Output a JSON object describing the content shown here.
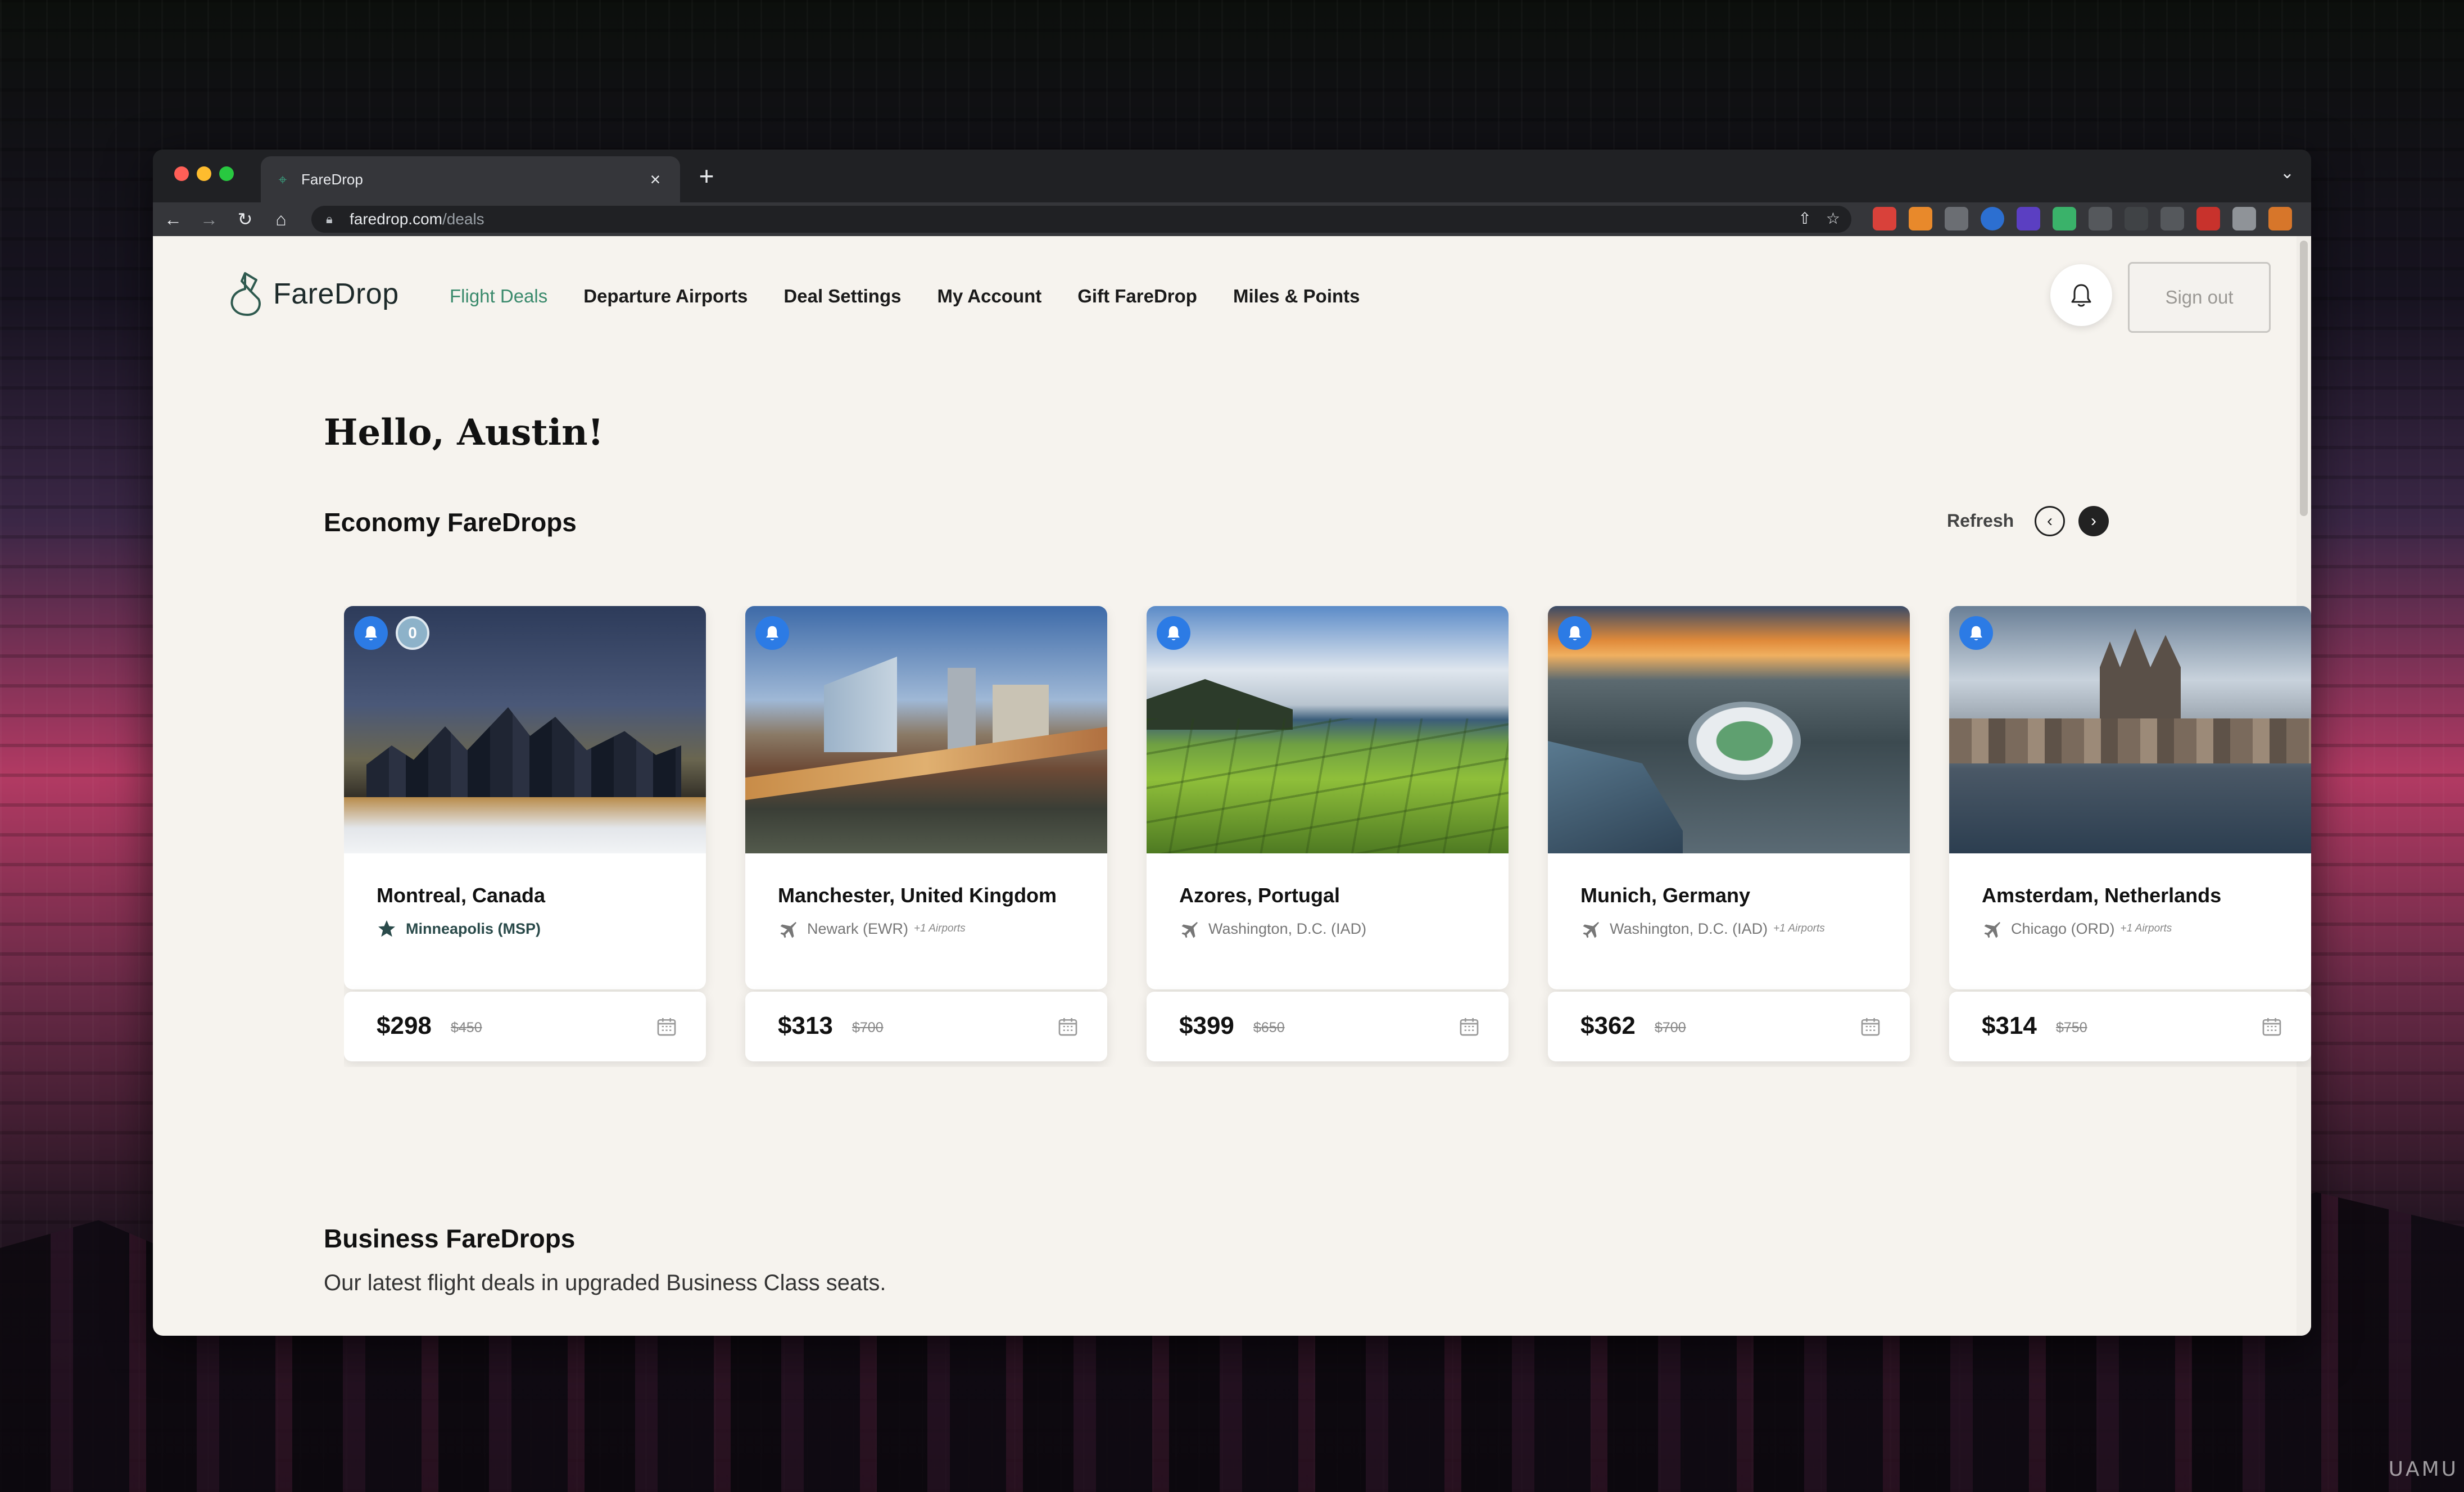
{
  "browser": {
    "tab_title": "FareDrop",
    "url_host": "faredrop.com",
    "url_path": "/deals"
  },
  "header": {
    "logo_text": "FareDrop",
    "nav": [
      {
        "label": "Flight Deals",
        "active": true
      },
      {
        "label": "Departure Airports",
        "active": false
      },
      {
        "label": "Deal Settings",
        "active": false
      },
      {
        "label": "My Account",
        "active": false
      },
      {
        "label": "Gift FareDrop",
        "active": false
      },
      {
        "label": "Miles & Points",
        "active": false
      }
    ],
    "signout_label": "Sign out"
  },
  "main": {
    "greeting": "Hello, Austin!",
    "economy_title": "Economy FareDrops",
    "refresh_label": "Refresh",
    "business_title": "Business FareDrops",
    "business_subtitle": "Our latest flight deals in upgraded Business Class seats."
  },
  "deals": [
    {
      "city": "Montreal, Canada",
      "origin": "Minneapolis (MSP)",
      "extra": "",
      "price": "$298",
      "old_price": "$450",
      "origin_icon": "star-icon",
      "badge_zero": "0"
    },
    {
      "city": "Manchester, United Kingdom",
      "origin": "Newark (EWR)",
      "extra": "+1 Airports",
      "price": "$313",
      "old_price": "$700",
      "origin_icon": "plane-icon"
    },
    {
      "city": "Azores, Portugal",
      "origin": "Washington, D.C. (IAD)",
      "extra": "",
      "price": "$399",
      "old_price": "$650",
      "origin_icon": "plane-icon"
    },
    {
      "city": "Munich, Germany",
      "origin": "Washington, D.C. (IAD)",
      "extra": "+1 Airports",
      "price": "$362",
      "old_price": "$700",
      "origin_icon": "plane-icon"
    },
    {
      "city": "Amsterdam, Netherlands",
      "origin": "Chicago (ORD)",
      "extra": "+1 Airports",
      "price": "$314",
      "old_price": "$750",
      "origin_icon": "plane-icon"
    }
  ],
  "colors": {
    "accent": "#3a8a6c",
    "badge_blue": "#2c7be5",
    "page_bg": "#f6f3ee"
  }
}
